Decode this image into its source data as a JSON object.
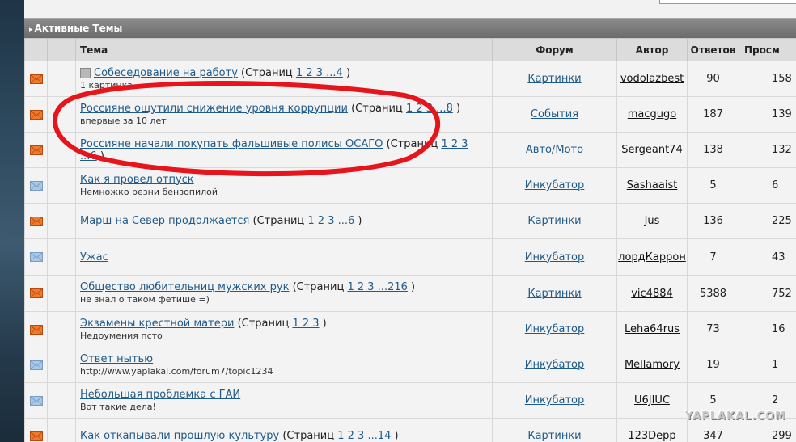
{
  "section": {
    "title": "Активные Темы"
  },
  "columns": {
    "topic": "Тема",
    "forum": "Форум",
    "author": "Автор",
    "replies": "Ответов",
    "views": "Просм"
  },
  "rows": [
    {
      "title": "Собеседование на работу",
      "pages_prefix": "(Страниц",
      "pages": "1 2 3 ...4",
      "pages_suffix": ")",
      "desc": "1 картинка",
      "forum": "Картинки",
      "author": "vodolazbest",
      "replies": "90",
      "views": "158",
      "icon": "hot",
      "pinned": true
    },
    {
      "title": "Россияне ощутили снижение уровня коррупции",
      "pages_prefix": "(Страниц",
      "pages": "1 2 3 ...8",
      "pages_suffix": ")",
      "desc": "впервые за 10 лет",
      "forum": "События",
      "author": "macgugo",
      "replies": "187",
      "views": "139",
      "icon": "hot"
    },
    {
      "title": "Россияне начали покупать фальшивые полисы ОСАГО",
      "pages_prefix": "(Страниц",
      "pages": "1 2 3",
      "pages_wrap": "...6",
      "pages_suffix": ")",
      "desc": "",
      "forum": "Авто/Мото",
      "author": "Sergeant74",
      "replies": "138",
      "views": "132",
      "icon": "hot"
    },
    {
      "title": "Как я провел отпуск",
      "desc": "Немножко резни бензопилой",
      "forum": "Инкубатор",
      "author": "Sashaaist",
      "replies": "5",
      "views": "6",
      "icon": "normal"
    },
    {
      "title": "Марш на Север продолжается",
      "pages_prefix": "(Страниц",
      "pages": "1 2 3 ...6",
      "pages_suffix": ")",
      "desc": "",
      "forum": "Картинки",
      "author": "Jus",
      "replies": "136",
      "views": "225",
      "icon": "hot"
    },
    {
      "title": "Ужас",
      "desc": "",
      "forum": "Инкубатор",
      "author": "лордКаррон",
      "replies": "7",
      "views": "43",
      "icon": "normal",
      "author_plain": true
    },
    {
      "title": "Общество любительниц мужских рук",
      "pages_prefix": "(Страниц",
      "pages": "1 2 3 ...216",
      "pages_suffix": ")",
      "desc": "не знал о таком фетише =)",
      "forum": "Картинки",
      "author": "vic4884",
      "replies": "5388",
      "views": "752",
      "icon": "hot"
    },
    {
      "title": "Экзамены крестной матери",
      "pages_prefix": "(Страниц",
      "pages": "1 2 3",
      "pages_suffix": ")",
      "desc": "Недоумения псто",
      "forum": "Инкубатор",
      "author": "Leha64rus",
      "replies": "73",
      "views": "16",
      "icon": "hot"
    },
    {
      "title": "Ответ нытью",
      "desc": "http://www.yaplakal.com/forum7/topic1234",
      "forum": "Инкубатор",
      "author": "Mellamory",
      "replies": "19",
      "views": "1",
      "icon": "normal"
    },
    {
      "title": "Небольшая проблемка с ГАИ",
      "desc": "Вот такие дела!",
      "forum": "Инкубатор",
      "author": "U6JIUC",
      "replies": "5",
      "views": "2",
      "icon": "normal"
    },
    {
      "title": "Как откапывали прошлую культуру",
      "pages_prefix": "(Страниц",
      "pages": "1 2 3 ...14",
      "pages_suffix": ")",
      "desc": "",
      "forum": "Картинки",
      "author": "123Depp",
      "replies": "347",
      "views": "299",
      "icon": "hot"
    }
  ],
  "watermark": "YAPLAKAL.COM",
  "colors": {
    "hot_icon": "#f07a2a",
    "normal_icon": "#a8c8e8",
    "link": "#1f5a8a",
    "annotation_red": "#e8141c"
  },
  "icons": {
    "section_arrow": "triangle-right-icon",
    "topic_status": "envelope-icon",
    "pinned": "pin-icon"
  }
}
